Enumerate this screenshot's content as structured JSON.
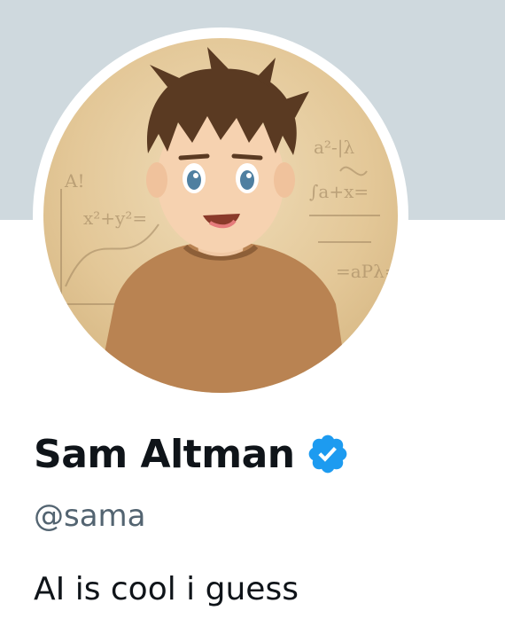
{
  "profile": {
    "display_name": "Sam Altman",
    "handle": "@sama",
    "bio": "AI is cool i guess",
    "verified": true,
    "avatar_icon": "anime-boy-avatar"
  },
  "colors": {
    "banner": "#cfd9de",
    "name": "#0f1419",
    "handle": "#536471",
    "verified_badge": "#1d9bf0"
  },
  "icons": {
    "verified": "verified-badge-icon"
  }
}
